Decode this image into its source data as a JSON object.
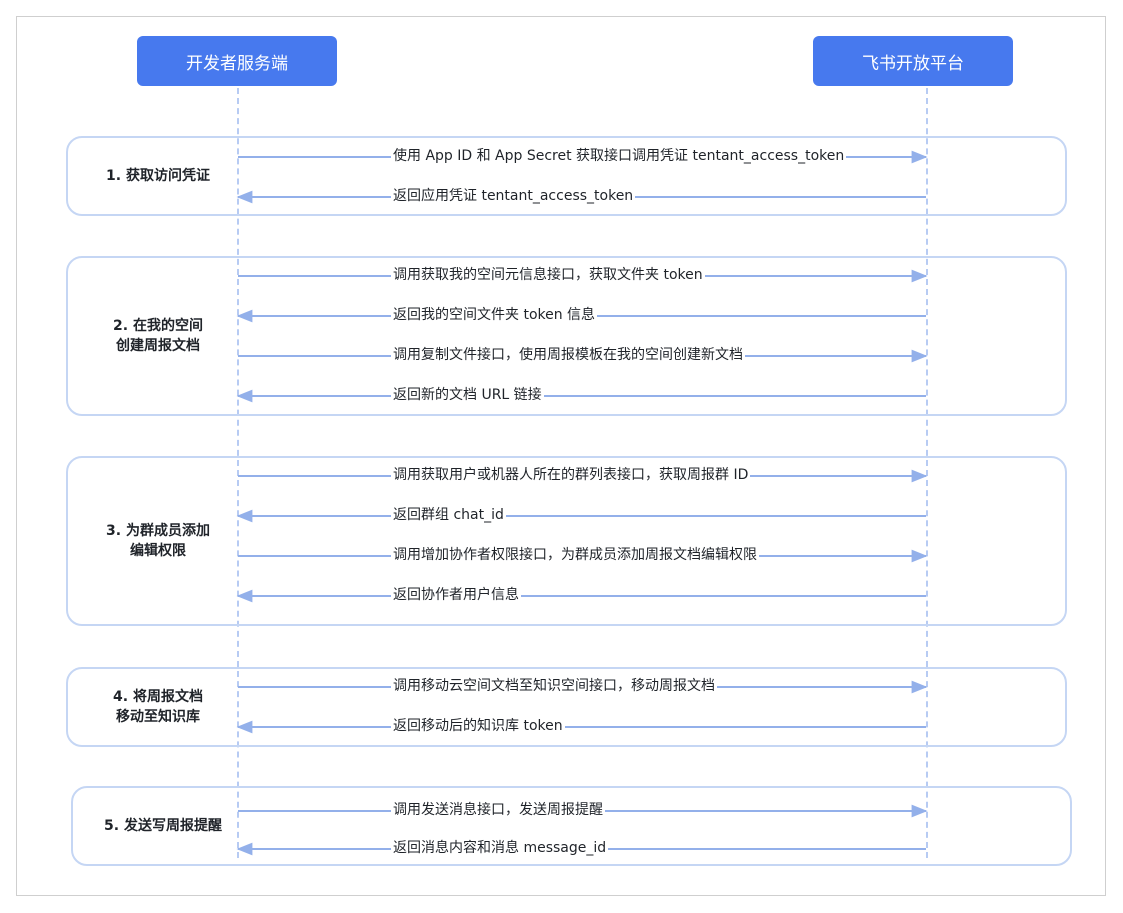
{
  "actors": {
    "left": "开发者服务端",
    "right": "飞书开放平台"
  },
  "colors": {
    "actor_fill": "#4779ee",
    "arrow": "#93b0ea",
    "box_border": "#c5d6f4",
    "lifeline": "#b7cbf3"
  },
  "steps": [
    {
      "label": "1. 获取访问凭证",
      "messages": [
        {
          "text": "使用 App ID 和 App Secret 获取接口调用凭证 tentant_access_token",
          "direction": "right"
        },
        {
          "text": "返回应用凭证 tentant_access_token",
          "direction": "left"
        }
      ]
    },
    {
      "label": "2. 在我的空间\n创建周报文档",
      "messages": [
        {
          "text": "调用获取我的空间元信息接口，获取文件夹 token",
          "direction": "right"
        },
        {
          "text": "返回我的空间文件夹 token 信息",
          "direction": "left"
        },
        {
          "text": "调用复制文件接口，使用周报模板在我的空间创建新文档",
          "direction": "right"
        },
        {
          "text": "返回新的文档 URL 链接",
          "direction": "left"
        }
      ]
    },
    {
      "label": "3. 为群成员添加\n编辑权限",
      "messages": [
        {
          "text": "调用获取用户或机器人所在的群列表接口，获取周报群 ID",
          "direction": "right"
        },
        {
          "text": "返回群组 chat_id",
          "direction": "left"
        },
        {
          "text": "调用增加协作者权限接口，为群成员添加周报文档编辑权限",
          "direction": "right"
        },
        {
          "text": "返回协作者用户信息",
          "direction": "left"
        }
      ]
    },
    {
      "label": "4. 将周报文档\n移动至知识库",
      "messages": [
        {
          "text": "调用移动云空间文档至知识空间接口，移动周报文档",
          "direction": "right"
        },
        {
          "text": "返回移动后的知识库 token",
          "direction": "left"
        }
      ]
    },
    {
      "label": "5. 发送写周报提醒",
      "messages": [
        {
          "text": "调用发送消息接口，发送周报提醒",
          "direction": "right"
        },
        {
          "text": "返回消息内容和消息 message_id",
          "direction": "left"
        }
      ]
    }
  ]
}
